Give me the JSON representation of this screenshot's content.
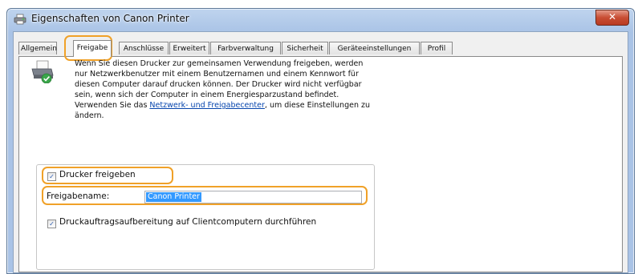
{
  "window": {
    "title": "Eigenschaften von Canon Printer",
    "close_symbol": "✕",
    "app_icon": "printer-icon"
  },
  "tabs": [
    {
      "label": "Allgemein"
    },
    {
      "label": "Freigabe",
      "active": true
    },
    {
      "label": "Anschlüsse"
    },
    {
      "label": "Erweitert"
    },
    {
      "label": "Farbverwaltung"
    },
    {
      "label": "Sicherheit"
    },
    {
      "label": "Geräteeinstellungen"
    },
    {
      "label": "Profil"
    }
  ],
  "sharing": {
    "description_part1": "Wenn Sie diesen Drucker zur gemeinsamen Verwendung freigeben, werden nur Netzwerkbenutzer mit einem Benutzernamen und einem Kennwort für diesen Computer darauf drucken können. Der Drucker wird nicht verfügbar sein, wenn sich der Computer in einem Energiesparzustand befindet. Verwenden Sie das ",
    "description_link": "Netzwerk- und Freigabecenter",
    "description_part2": ", um diese Einstellungen zu ändern.",
    "share_checkbox_label": "Drucker freigeben",
    "share_checked": true,
    "share_name_label": "Freigabename:",
    "share_name_value": "Canon Printer",
    "render_checkbox_label": "Druckauftragsaufbereitung auf Clientcomputern durchführen",
    "render_checked": true,
    "check_symbol": "✓"
  },
  "highlight_color": "#f0a128"
}
